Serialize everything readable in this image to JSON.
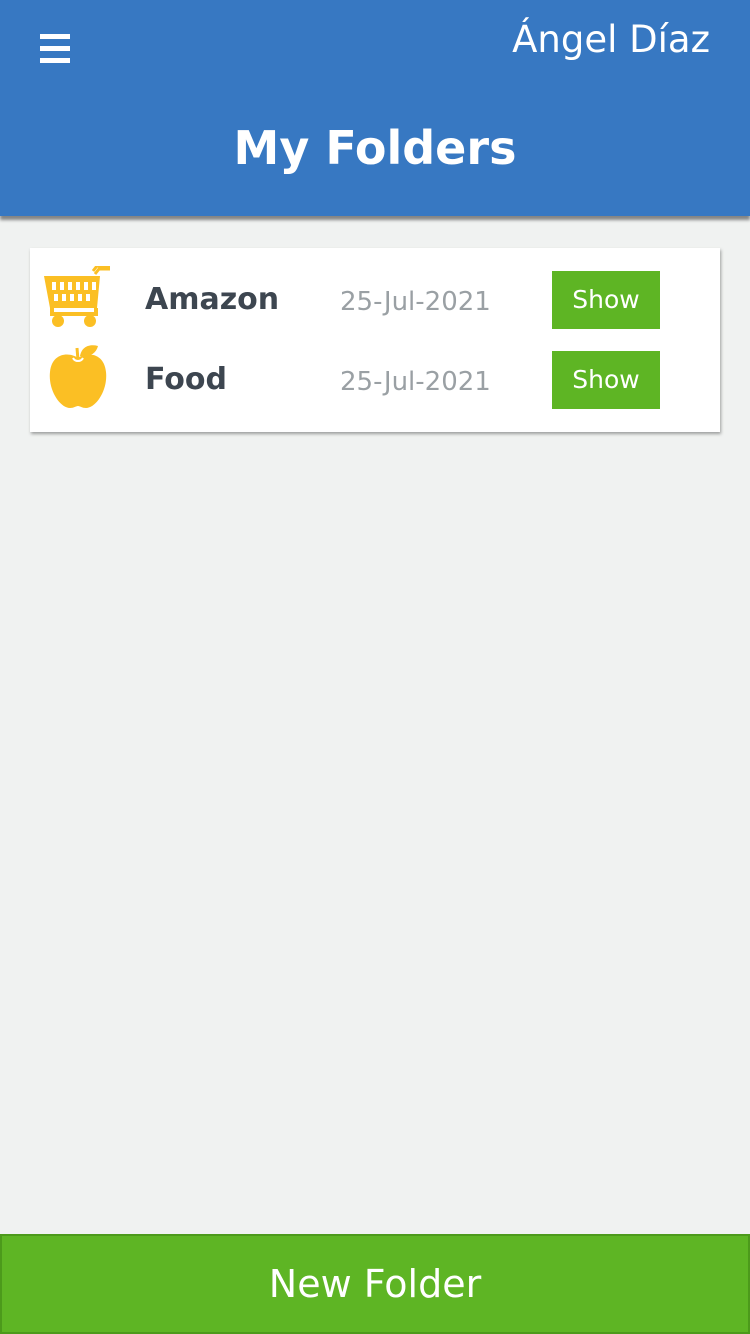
{
  "header": {
    "user_name": "Ángel Díaz",
    "title": "My Folders",
    "menu_icon": "hamburger-menu-icon",
    "background_color": "#3778c2"
  },
  "folders": [
    {
      "name": "Amazon",
      "date": "25-Jul-2021",
      "icon": "shopping-cart-icon",
      "action_label": "Show"
    },
    {
      "name": "Food",
      "date": "25-Jul-2021",
      "icon": "apple-icon",
      "action_label": "Show"
    }
  ],
  "footer": {
    "new_folder_label": "New Folder"
  },
  "colors": {
    "accent_green": "#5eb524",
    "icon_yellow": "#fbbf24",
    "page_background": "#f0f2f1"
  }
}
